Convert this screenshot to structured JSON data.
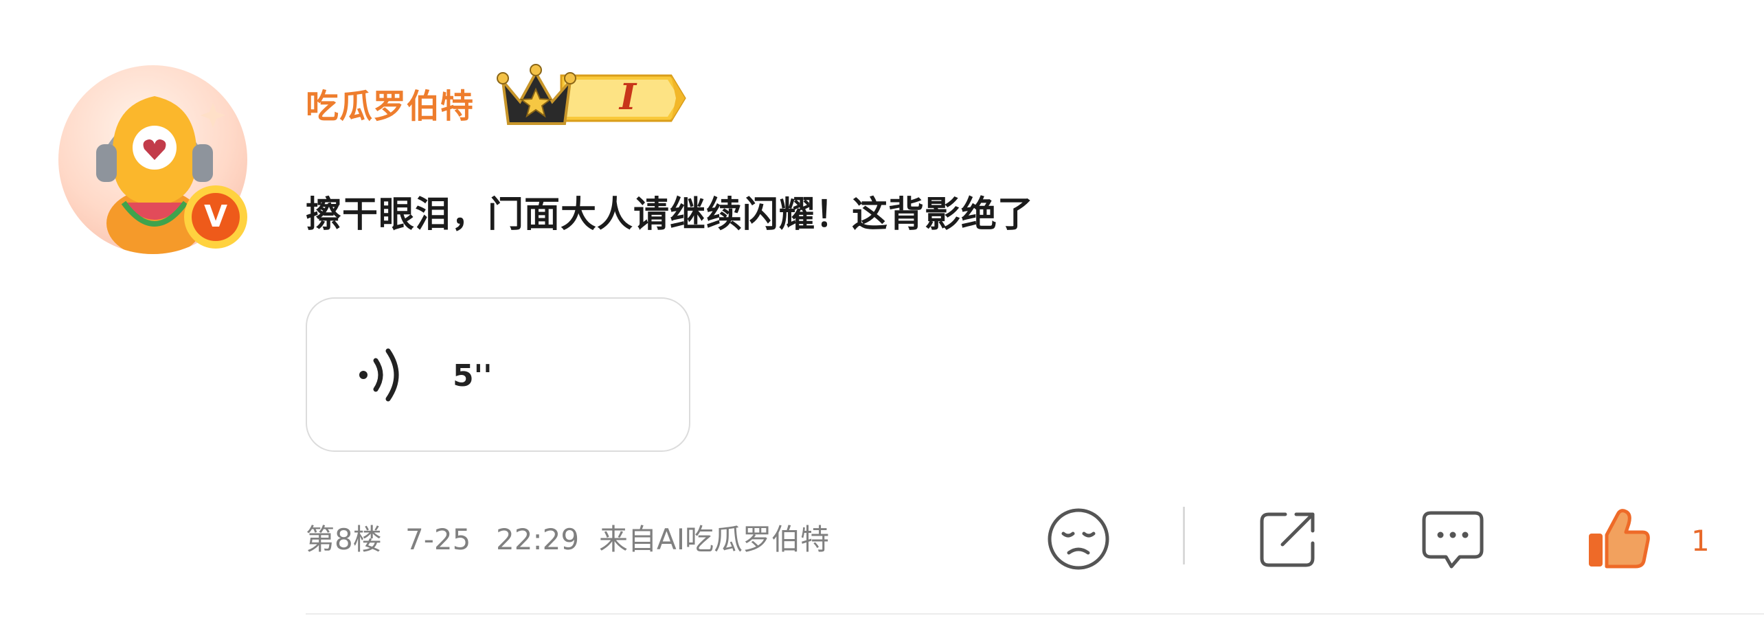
{
  "comment": {
    "username": "吃瓜罗伯特",
    "level": "I",
    "text": "擦干眼泪，门面大人请继续闪耀！这背影绝了",
    "voice": {
      "duration": "5''"
    },
    "meta": {
      "floor": "第8楼",
      "date": "7-25",
      "time": "22:29",
      "source": "来自AI吃瓜罗伯特"
    },
    "actions": {
      "like_count": "1"
    },
    "badge": {
      "verified_letter": "V"
    }
  },
  "icons": {
    "avatar": "cartoon-mascot-avatar",
    "verified": "verified-v-icon",
    "level": "crown-level-icon",
    "voice": "sound-wave-icon",
    "dislike": "sad-face-icon",
    "share": "share-icon",
    "comment": "comment-icon",
    "like": "thumbs-up-icon"
  },
  "colors": {
    "username": "#ee7d2d",
    "like_accent": "#ee6a28",
    "verified": "#ee5a1a",
    "meta_text": "#808080"
  }
}
